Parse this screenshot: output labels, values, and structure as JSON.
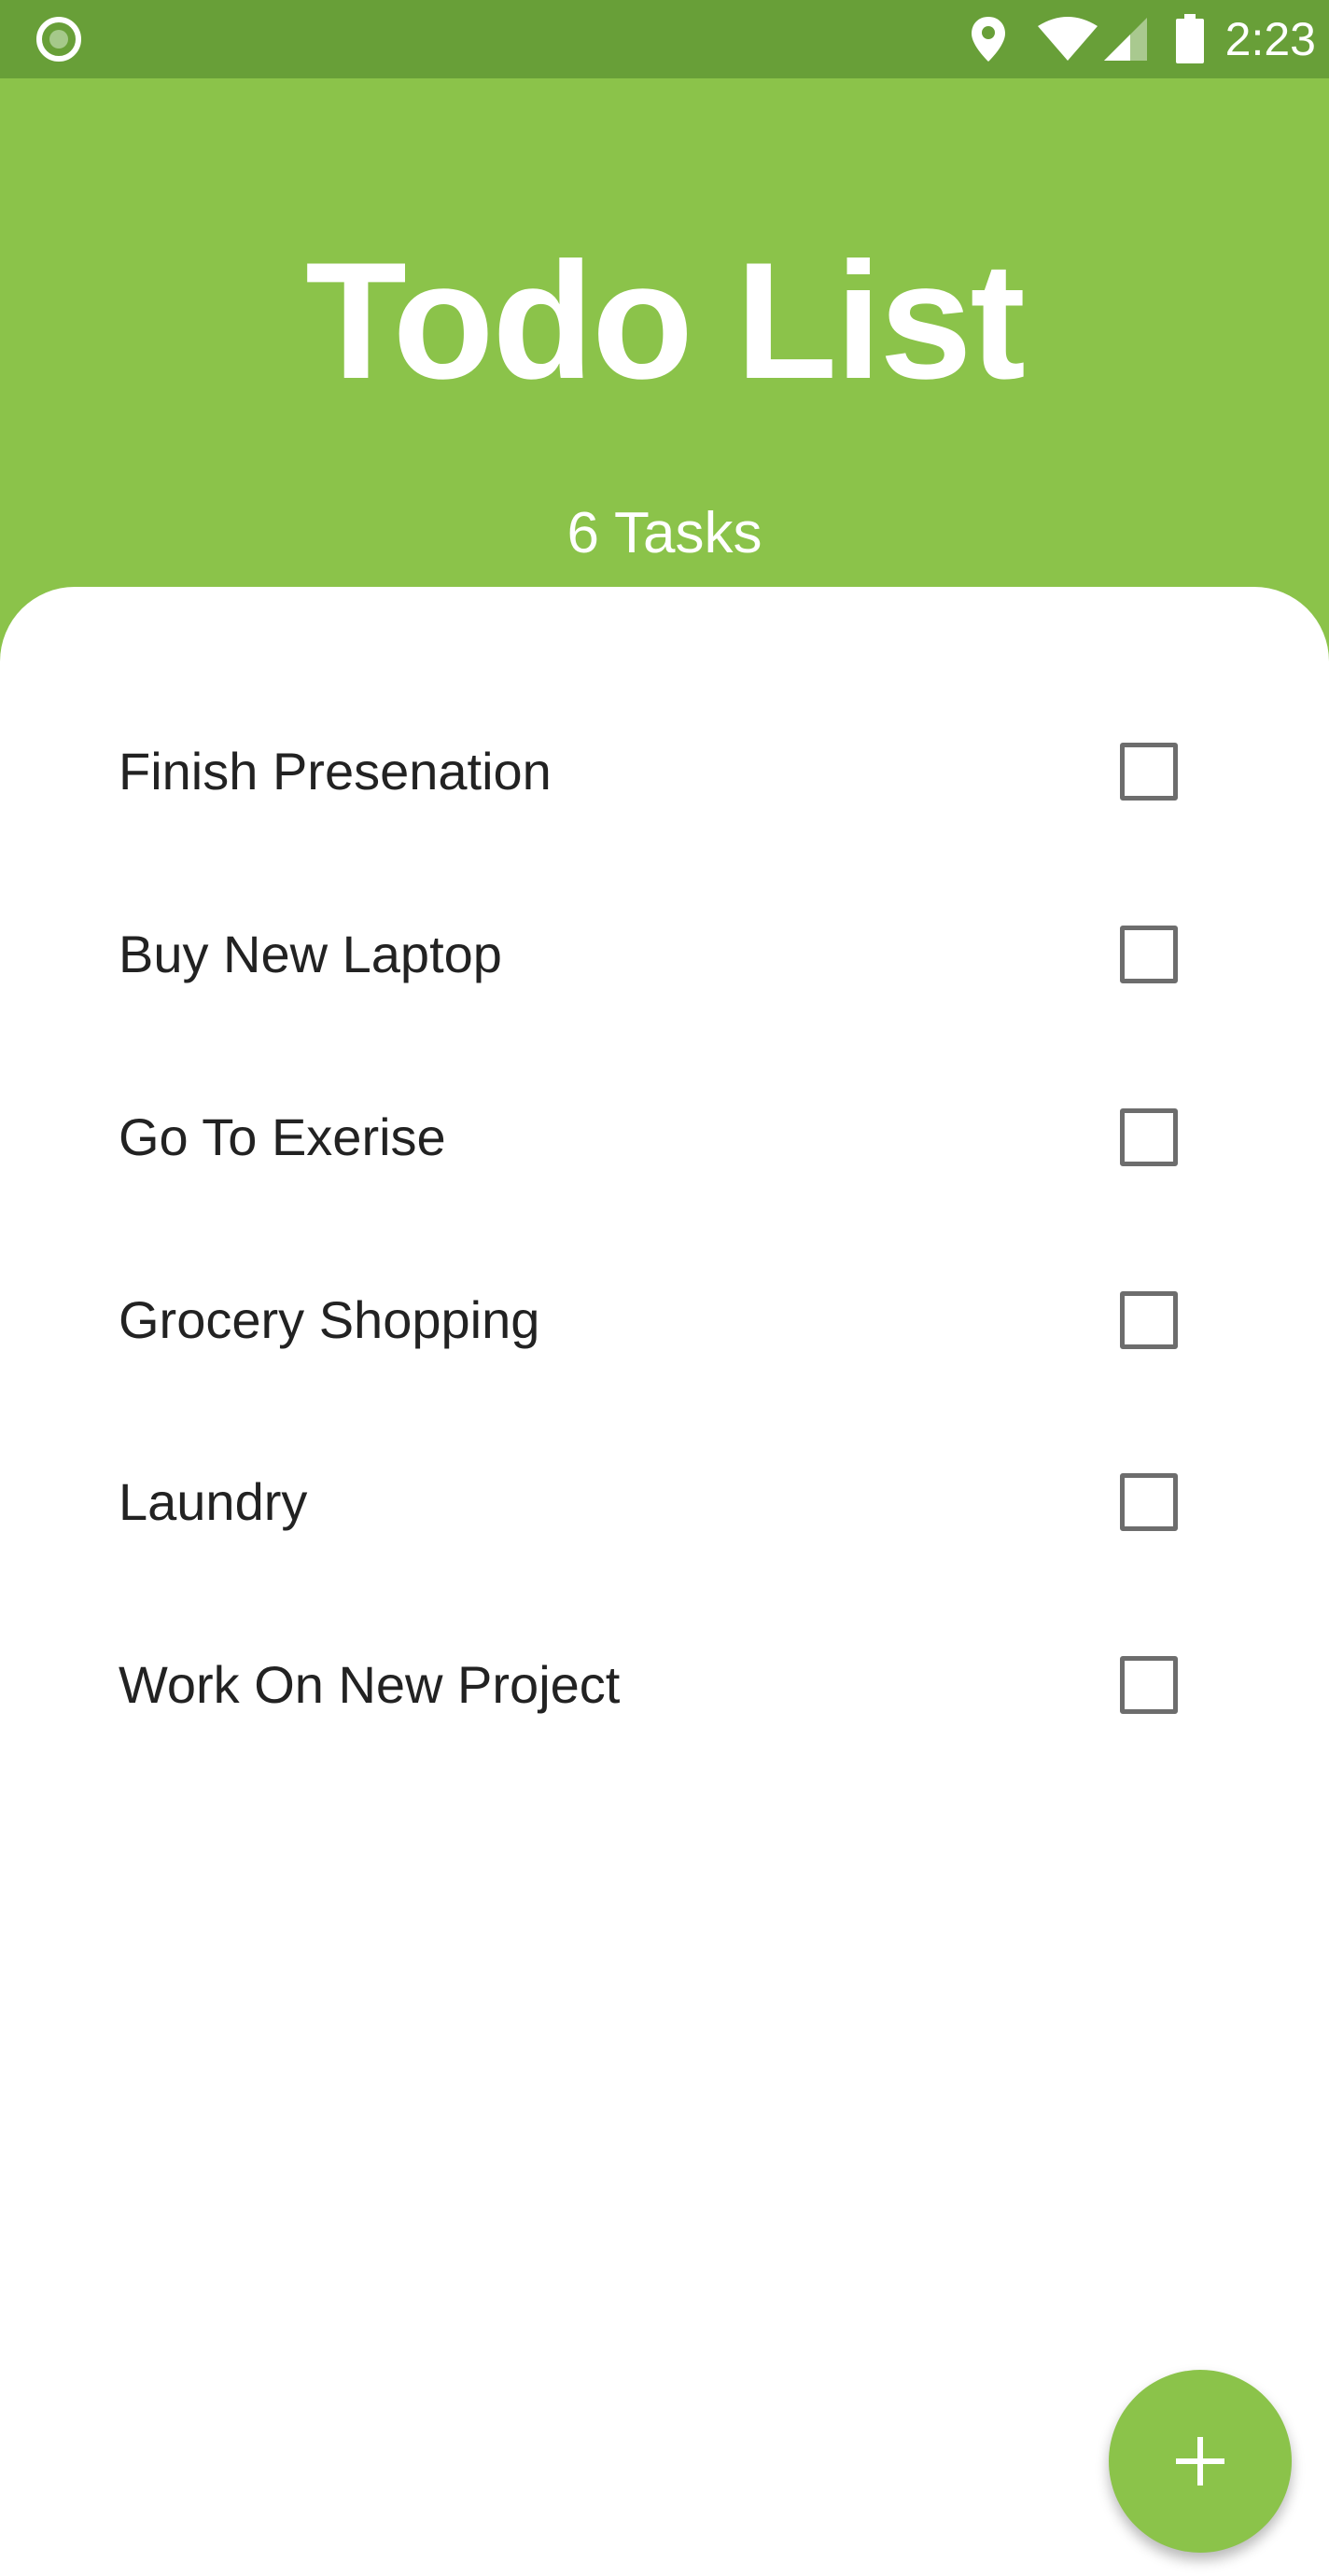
{
  "status_bar": {
    "time": "2:23",
    "left_icon": "record-circle-icon",
    "right_icons": [
      "location-pin-icon",
      "wifi-icon",
      "cellular-signal-icon",
      "battery-icon"
    ],
    "color": "#689F38"
  },
  "header": {
    "title": "Todo List",
    "subtitle": "6 Tasks",
    "color": "#8BC34A"
  },
  "tasks": [
    {
      "label": "Finish Presenation",
      "checked": false
    },
    {
      "label": "Buy New Laptop",
      "checked": false
    },
    {
      "label": "Go To Exerise",
      "checked": false
    },
    {
      "label": "Grocery Shopping",
      "checked": false
    },
    {
      "label": "Laundry",
      "checked": false
    },
    {
      "label": "Work On New Project",
      "checked": false
    }
  ],
  "fab": {
    "icon": "plus-icon",
    "color": "#8BC34A"
  }
}
